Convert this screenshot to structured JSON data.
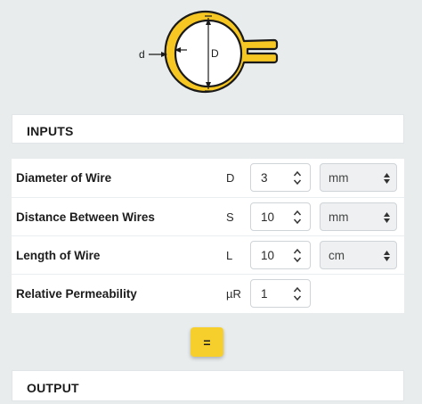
{
  "diagram": {
    "small_label": "d",
    "large_label": "D"
  },
  "inputs_header": "INPUTS",
  "rows": [
    {
      "label": "Diameter of Wire",
      "symbol": "D",
      "value": "3",
      "unit": "mm"
    },
    {
      "label": "Distance Between Wires",
      "symbol": "S",
      "value": "10",
      "unit": "mm"
    },
    {
      "label": "Length of Wire",
      "symbol": "L",
      "value": "10",
      "unit": "cm"
    },
    {
      "label": "Relative Permeability",
      "symbol": "µR",
      "value": "1",
      "unit": ""
    }
  ],
  "calculate_label": "=",
  "output_header": "OUTPUT",
  "colors": {
    "accent": "#f7cf2c",
    "wire": "#f6c623",
    "background": "#e8eced"
  }
}
